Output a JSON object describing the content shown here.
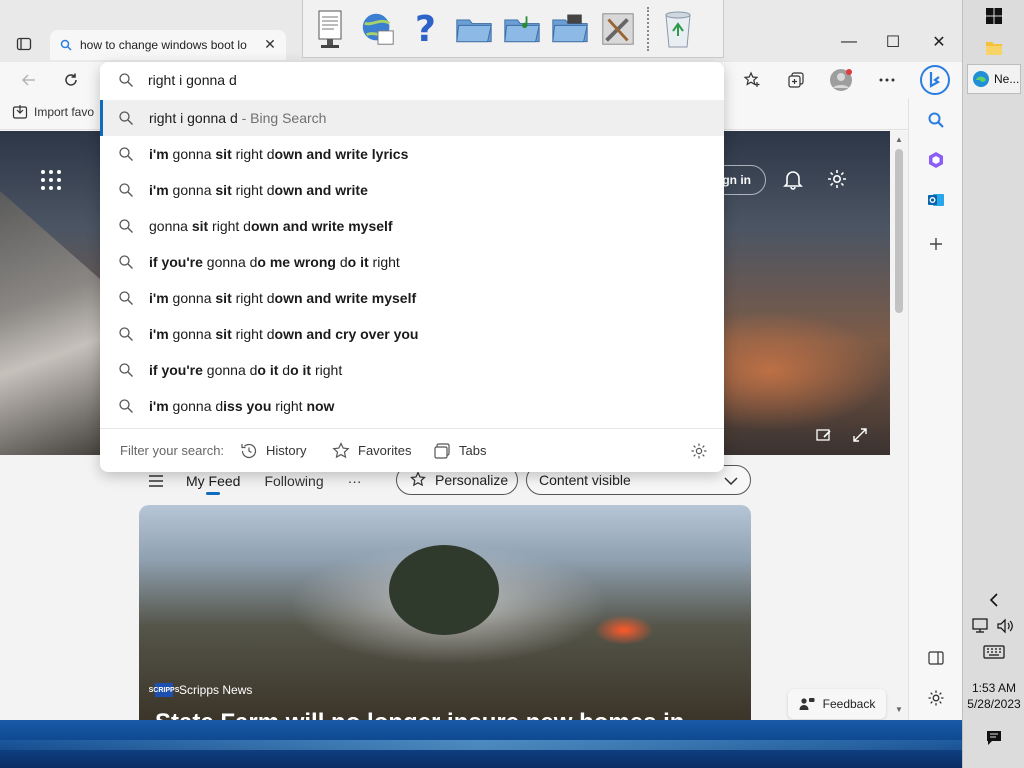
{
  "browser": {
    "tab_title": "how to change windows boot lo",
    "tab_close": "✕",
    "min": "—",
    "max": "☐",
    "close": "✕",
    "favorites_item": "Import favo"
  },
  "omnibox": {
    "query": "right i gonna d",
    "top_suggestion": "right i gonna d",
    "top_suggestion_suffix": " - Bing Search",
    "suggestions": [
      [
        {
          "t": "i'm",
          "b": true
        },
        {
          "t": " gonna ",
          "b": false
        },
        {
          "t": "sit",
          "b": true
        },
        {
          "t": " right d",
          "b": false
        },
        {
          "t": "own and write lyrics",
          "b": true
        }
      ],
      [
        {
          "t": "i'm",
          "b": true
        },
        {
          "t": " gonna ",
          "b": false
        },
        {
          "t": "sit",
          "b": true
        },
        {
          "t": " right d",
          "b": false
        },
        {
          "t": "own and write",
          "b": true
        }
      ],
      [
        {
          "t": "gonna ",
          "b": false
        },
        {
          "t": "sit",
          "b": true
        },
        {
          "t": " right d",
          "b": false
        },
        {
          "t": "own and write myself",
          "b": true
        }
      ],
      [
        {
          "t": "if you're",
          "b": true
        },
        {
          "t": " gonna d",
          "b": false
        },
        {
          "t": "o me wrong",
          "b": true
        },
        {
          "t": " d",
          "b": false
        },
        {
          "t": "o it",
          "b": true
        },
        {
          "t": " right",
          "b": false
        }
      ],
      [
        {
          "t": "i'm",
          "b": true
        },
        {
          "t": " gonna ",
          "b": false
        },
        {
          "t": "sit",
          "b": true
        },
        {
          "t": " right d",
          "b": false
        },
        {
          "t": "own and write myself",
          "b": true
        }
      ],
      [
        {
          "t": "i'm",
          "b": true
        },
        {
          "t": " gonna ",
          "b": false
        },
        {
          "t": "sit",
          "b": true
        },
        {
          "t": " right d",
          "b": false
        },
        {
          "t": "own and cry over you",
          "b": true
        }
      ],
      [
        {
          "t": "if you're",
          "b": true
        },
        {
          "t": " gonna d",
          "b": false
        },
        {
          "t": "o it",
          "b": true
        },
        {
          "t": " d",
          "b": false
        },
        {
          "t": "o it",
          "b": true
        },
        {
          "t": " right",
          "b": false
        }
      ],
      [
        {
          "t": "i'm",
          "b": true
        },
        {
          "t": " gonna d",
          "b": false
        },
        {
          "t": "iss you",
          "b": true
        },
        {
          "t": " right ",
          "b": false
        },
        {
          "t": "now",
          "b": true
        }
      ]
    ],
    "filter_label": "Filter your search:",
    "filter_history": "History",
    "filter_favorites": "Favorites",
    "filter_tabs": "Tabs"
  },
  "page": {
    "signin": "gn in",
    "feed_tabs": [
      "My Feed",
      "Following"
    ],
    "more": "···",
    "personalize": "Personalize",
    "content_visible": "Content visible",
    "news_source": "Scripps News",
    "news_source_logo": "SCRIPPS",
    "headline": "State Farm will no longer insure new homes in",
    "feedback": "Feedback"
  },
  "taskbar": {
    "app_label": "Ne...",
    "time": "1:53 AM",
    "date": "5/28/2023"
  },
  "colors": {
    "accent": "#0f6cbd",
    "bing": "#2a7de1"
  }
}
